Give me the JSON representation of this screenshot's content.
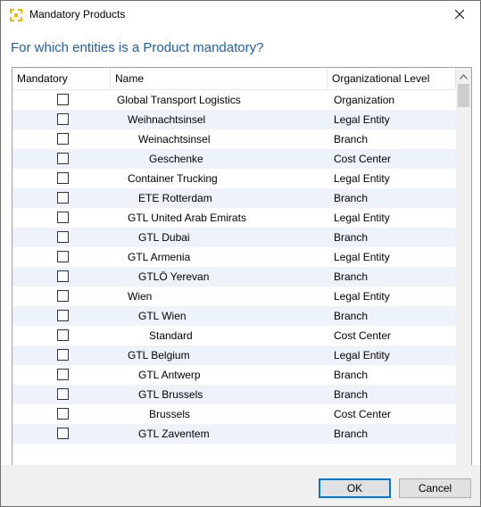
{
  "window": {
    "title": "Mandatory Products",
    "app_icon": "product-app-icon",
    "close_icon": "close-icon"
  },
  "question": "For which entities is a Product mandatory?",
  "grid": {
    "columns": [
      "Mandatory",
      "Name",
      "Organizational Level"
    ],
    "rows": [
      {
        "name": "Global Transport Logistics",
        "level": "Organization",
        "indent": 0,
        "checked": false
      },
      {
        "name": "Weihnachtsinsel",
        "level": "Legal Entity",
        "indent": 1,
        "checked": false
      },
      {
        "name": "Weinachtsinsel",
        "level": "Branch",
        "indent": 2,
        "checked": false
      },
      {
        "name": "Geschenke",
        "level": "Cost Center",
        "indent": 3,
        "checked": false
      },
      {
        "name": "Container Trucking",
        "level": "Legal Entity",
        "indent": 1,
        "checked": false
      },
      {
        "name": "ETE Rotterdam",
        "level": "Branch",
        "indent": 2,
        "checked": false
      },
      {
        "name": "GTL  United Arab Emirats",
        "level": "Legal Entity",
        "indent": 1,
        "checked": false
      },
      {
        "name": "GTL Dubai",
        "level": "Branch",
        "indent": 2,
        "checked": false
      },
      {
        "name": "GTL Armenia",
        "level": "Legal Entity",
        "indent": 1,
        "checked": false
      },
      {
        "name": "GTLÖ Yerevan",
        "level": "Branch",
        "indent": 2,
        "checked": false
      },
      {
        "name": "Wien",
        "level": "Legal Entity",
        "indent": 1,
        "checked": false
      },
      {
        "name": "GTL Wien",
        "level": "Branch",
        "indent": 2,
        "checked": false
      },
      {
        "name": "Standard",
        "level": "Cost Center",
        "indent": 3,
        "checked": false
      },
      {
        "name": "GTL Belgium",
        "level": "Legal Entity",
        "indent": 1,
        "checked": false
      },
      {
        "name": "GTL Antwerp",
        "level": "Branch",
        "indent": 2,
        "checked": false
      },
      {
        "name": "GTL Brussels",
        "level": "Branch",
        "indent": 2,
        "checked": false
      },
      {
        "name": "Brussels",
        "level": "Cost Center",
        "indent": 3,
        "checked": false
      },
      {
        "name": "GTL Zaventem",
        "level": "Branch",
        "indent": 2,
        "checked": false
      }
    ]
  },
  "buttons": {
    "ok": "OK",
    "cancel": "Cancel"
  },
  "colors": {
    "question_text": "#1f5fa6",
    "row_alt": "#eef3fb",
    "default_button_border": "#0078d7"
  }
}
